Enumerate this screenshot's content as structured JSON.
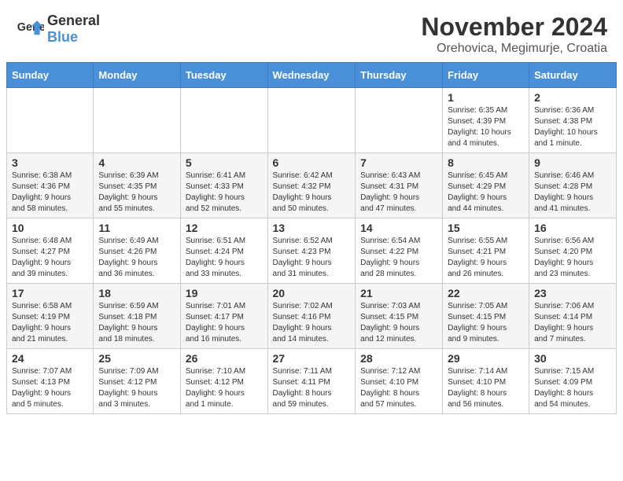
{
  "header": {
    "logo_general": "General",
    "logo_blue": "Blue",
    "month_title": "November 2024",
    "subtitle": "Orehovica, Megimurje, Croatia"
  },
  "calendar": {
    "days_of_week": [
      "Sunday",
      "Monday",
      "Tuesday",
      "Wednesday",
      "Thursday",
      "Friday",
      "Saturday"
    ],
    "weeks": [
      [
        {
          "day": "",
          "info": ""
        },
        {
          "day": "",
          "info": ""
        },
        {
          "day": "",
          "info": ""
        },
        {
          "day": "",
          "info": ""
        },
        {
          "day": "",
          "info": ""
        },
        {
          "day": "1",
          "info": "Sunrise: 6:35 AM\nSunset: 4:39 PM\nDaylight: 10 hours\nand 4 minutes."
        },
        {
          "day": "2",
          "info": "Sunrise: 6:36 AM\nSunset: 4:38 PM\nDaylight: 10 hours\nand 1 minute."
        }
      ],
      [
        {
          "day": "3",
          "info": "Sunrise: 6:38 AM\nSunset: 4:36 PM\nDaylight: 9 hours\nand 58 minutes."
        },
        {
          "day": "4",
          "info": "Sunrise: 6:39 AM\nSunset: 4:35 PM\nDaylight: 9 hours\nand 55 minutes."
        },
        {
          "day": "5",
          "info": "Sunrise: 6:41 AM\nSunset: 4:33 PM\nDaylight: 9 hours\nand 52 minutes."
        },
        {
          "day": "6",
          "info": "Sunrise: 6:42 AM\nSunset: 4:32 PM\nDaylight: 9 hours\nand 50 minutes."
        },
        {
          "day": "7",
          "info": "Sunrise: 6:43 AM\nSunset: 4:31 PM\nDaylight: 9 hours\nand 47 minutes."
        },
        {
          "day": "8",
          "info": "Sunrise: 6:45 AM\nSunset: 4:29 PM\nDaylight: 9 hours\nand 44 minutes."
        },
        {
          "day": "9",
          "info": "Sunrise: 6:46 AM\nSunset: 4:28 PM\nDaylight: 9 hours\nand 41 minutes."
        }
      ],
      [
        {
          "day": "10",
          "info": "Sunrise: 6:48 AM\nSunset: 4:27 PM\nDaylight: 9 hours\nand 39 minutes."
        },
        {
          "day": "11",
          "info": "Sunrise: 6:49 AM\nSunset: 4:26 PM\nDaylight: 9 hours\nand 36 minutes."
        },
        {
          "day": "12",
          "info": "Sunrise: 6:51 AM\nSunset: 4:24 PM\nDaylight: 9 hours\nand 33 minutes."
        },
        {
          "day": "13",
          "info": "Sunrise: 6:52 AM\nSunset: 4:23 PM\nDaylight: 9 hours\nand 31 minutes."
        },
        {
          "day": "14",
          "info": "Sunrise: 6:54 AM\nSunset: 4:22 PM\nDaylight: 9 hours\nand 28 minutes."
        },
        {
          "day": "15",
          "info": "Sunrise: 6:55 AM\nSunset: 4:21 PM\nDaylight: 9 hours\nand 26 minutes."
        },
        {
          "day": "16",
          "info": "Sunrise: 6:56 AM\nSunset: 4:20 PM\nDaylight: 9 hours\nand 23 minutes."
        }
      ],
      [
        {
          "day": "17",
          "info": "Sunrise: 6:58 AM\nSunset: 4:19 PM\nDaylight: 9 hours\nand 21 minutes."
        },
        {
          "day": "18",
          "info": "Sunrise: 6:59 AM\nSunset: 4:18 PM\nDaylight: 9 hours\nand 18 minutes."
        },
        {
          "day": "19",
          "info": "Sunrise: 7:01 AM\nSunset: 4:17 PM\nDaylight: 9 hours\nand 16 minutes."
        },
        {
          "day": "20",
          "info": "Sunrise: 7:02 AM\nSunset: 4:16 PM\nDaylight: 9 hours\nand 14 minutes."
        },
        {
          "day": "21",
          "info": "Sunrise: 7:03 AM\nSunset: 4:15 PM\nDaylight: 9 hours\nand 12 minutes."
        },
        {
          "day": "22",
          "info": "Sunrise: 7:05 AM\nSunset: 4:15 PM\nDaylight: 9 hours\nand 9 minutes."
        },
        {
          "day": "23",
          "info": "Sunrise: 7:06 AM\nSunset: 4:14 PM\nDaylight: 9 hours\nand 7 minutes."
        }
      ],
      [
        {
          "day": "24",
          "info": "Sunrise: 7:07 AM\nSunset: 4:13 PM\nDaylight: 9 hours\nand 5 minutes."
        },
        {
          "day": "25",
          "info": "Sunrise: 7:09 AM\nSunset: 4:12 PM\nDaylight: 9 hours\nand 3 minutes."
        },
        {
          "day": "26",
          "info": "Sunrise: 7:10 AM\nSunset: 4:12 PM\nDaylight: 9 hours\nand 1 minute."
        },
        {
          "day": "27",
          "info": "Sunrise: 7:11 AM\nSunset: 4:11 PM\nDaylight: 8 hours\nand 59 minutes."
        },
        {
          "day": "28",
          "info": "Sunrise: 7:12 AM\nSunset: 4:10 PM\nDaylight: 8 hours\nand 57 minutes."
        },
        {
          "day": "29",
          "info": "Sunrise: 7:14 AM\nSunset: 4:10 PM\nDaylight: 8 hours\nand 56 minutes."
        },
        {
          "day": "30",
          "info": "Sunrise: 7:15 AM\nSunset: 4:09 PM\nDaylight: 8 hours\nand 54 minutes."
        }
      ]
    ]
  }
}
